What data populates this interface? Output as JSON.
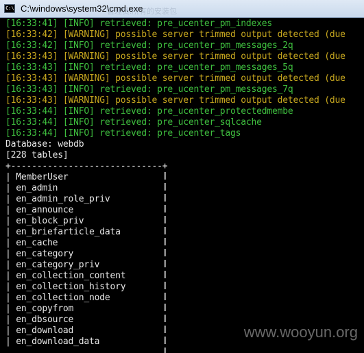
{
  "window": {
    "title": "C:\\windows\\system32\\cmd.exe",
    "icon_text": "C:\\",
    "overlay_text": "管理员:所有的安装包"
  },
  "log_lines": [
    {
      "text": "[16:33:41] [INFO] retrieved: pre_ucenter_pm_indexes",
      "level": "info"
    },
    {
      "text": "[16:33:42] [WARNING] possible server trimmed output detected (due",
      "level": "warning"
    },
    {
      "text": "[16:33:42] [INFO] retrieved: pre_ucenter_pm_messages_2q",
      "level": "info"
    },
    {
      "text": "[16:33:43] [WARNING] possible server trimmed output detected (due",
      "level": "warning"
    },
    {
      "text": "[16:33:43] [INFO] retrieved: pre_ucenter_pm_messages_5q",
      "level": "info"
    },
    {
      "text": "[16:33:43] [WARNING] possible server trimmed output detected (due",
      "level": "warning"
    },
    {
      "text": "[16:33:43] [INFO] retrieved: pre_ucenter_pm_messages_7q",
      "level": "info"
    },
    {
      "text": "[16:33:43] [WARNING] possible server trimmed output detected (due",
      "level": "warning"
    },
    {
      "text": "[16:33:44] [INFO] retrieved: pre_ucenter_protectedmembe",
      "level": "info"
    },
    {
      "text": "[16:33:44] [INFO] retrieved: pre_ucenter_sqlcache",
      "level": "info"
    },
    {
      "text": "[16:33:44] [INFO] retrieved: pre_ucenter_tags",
      "level": "info"
    }
  ],
  "database_line": "Database: webdb",
  "tables_count_line": "[228 tables]",
  "table_border": "+-----------------------------+",
  "tables": [
    "MemberUser",
    "en_admin",
    "en_admin_role_priv",
    "en_announce",
    "en_block_priv",
    "en_briefarticle_data",
    "en_cache",
    "en_category",
    "en_category_priv",
    "en_collection_content",
    "en_collection_history",
    "en_collection_node",
    "en_copyfrom",
    "en_dbsource",
    "en_download",
    "en_download_data"
  ],
  "watermark": "www.wooyun.org",
  "colors": {
    "info": "#3fbf3f",
    "warning": "#c8a81f",
    "plain": "#e8e8e8",
    "background": "#000000"
  }
}
